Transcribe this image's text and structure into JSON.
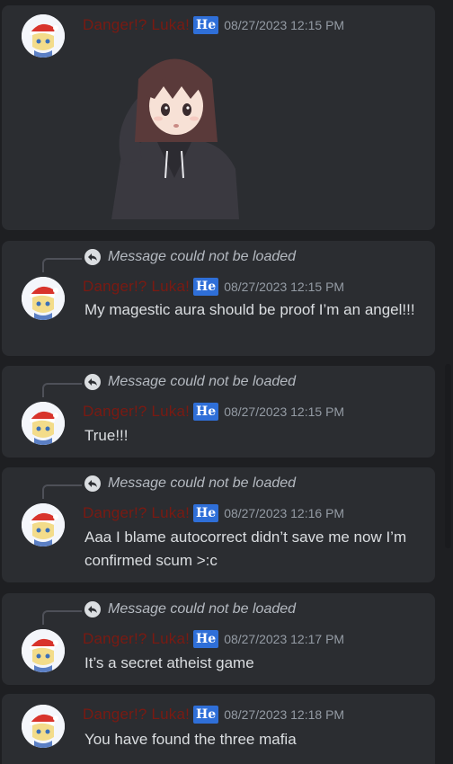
{
  "colors": {
    "background": "#1e1f22",
    "card": "#2b2d31",
    "username": "#7a1a12",
    "badge": "#2f6fd8",
    "text": "#dbdee1",
    "muted": "#949ba4"
  },
  "reply_placeholder": "Message could not be loaded",
  "messages": [
    {
      "username": "Danger!? Luka!",
      "badge": "He",
      "timestamp": "08/27/2023 12:15 PM",
      "text": "",
      "has_reply": false,
      "attachment": "sticker-girl-saluting"
    },
    {
      "username": "Danger!? Luka!",
      "badge": "He",
      "timestamp": "08/27/2023 12:15 PM",
      "text": "My magestic aura should be proof I’m an angel!!!",
      "has_reply": true
    },
    {
      "username": "Danger!? Luka!",
      "badge": "He",
      "timestamp": "08/27/2023 12:15 PM",
      "text": "True!!!",
      "has_reply": true
    },
    {
      "username": "Danger!? Luka!",
      "badge": "He",
      "timestamp": "08/27/2023 12:16 PM",
      "text": "Aaa I blame autocorrect didn’t save  me now I’m confirmed scum >:c",
      "has_reply": true
    },
    {
      "username": "Danger!? Luka!",
      "badge": "He",
      "timestamp": "08/27/2023 12:17 PM",
      "text": "It’s a secret atheist game",
      "has_reply": true
    },
    {
      "username": "Danger!? Luka!",
      "badge": "He",
      "timestamp": "08/27/2023 12:18 PM",
      "text": "You have found the three mafia",
      "has_reply": false
    }
  ]
}
